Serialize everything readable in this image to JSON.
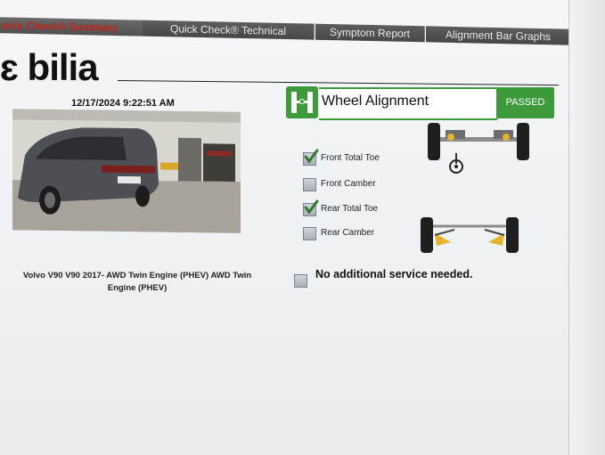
{
  "tabs": [
    {
      "label": "uick Check® Summary"
    },
    {
      "label": "Quick Check® Technical"
    },
    {
      "label": "Symptom Report"
    },
    {
      "label": "Alignment Bar Graphs"
    }
  ],
  "brand": {
    "logo_text": "bilia"
  },
  "report": {
    "timestamp": "12/17/2024 9:22:51 AM",
    "vehicle_description": "Volvo V90 V90 2017- AWD Twin Engine (PHEV) AWD Twin Engine (PHEV)"
  },
  "wheel_alignment": {
    "title": "Wheel Alignment",
    "status": "PASSED",
    "status_color": "#3c9a3a",
    "checks": [
      {
        "label": "Front Total Toe",
        "checked": true
      },
      {
        "label": "Front Camber",
        "checked": false
      },
      {
        "label": "Rear Total Toe",
        "checked": true
      },
      {
        "label": "Rear Camber",
        "checked": false
      }
    ]
  },
  "service": {
    "message": "No additional service needed.",
    "checked": false
  }
}
